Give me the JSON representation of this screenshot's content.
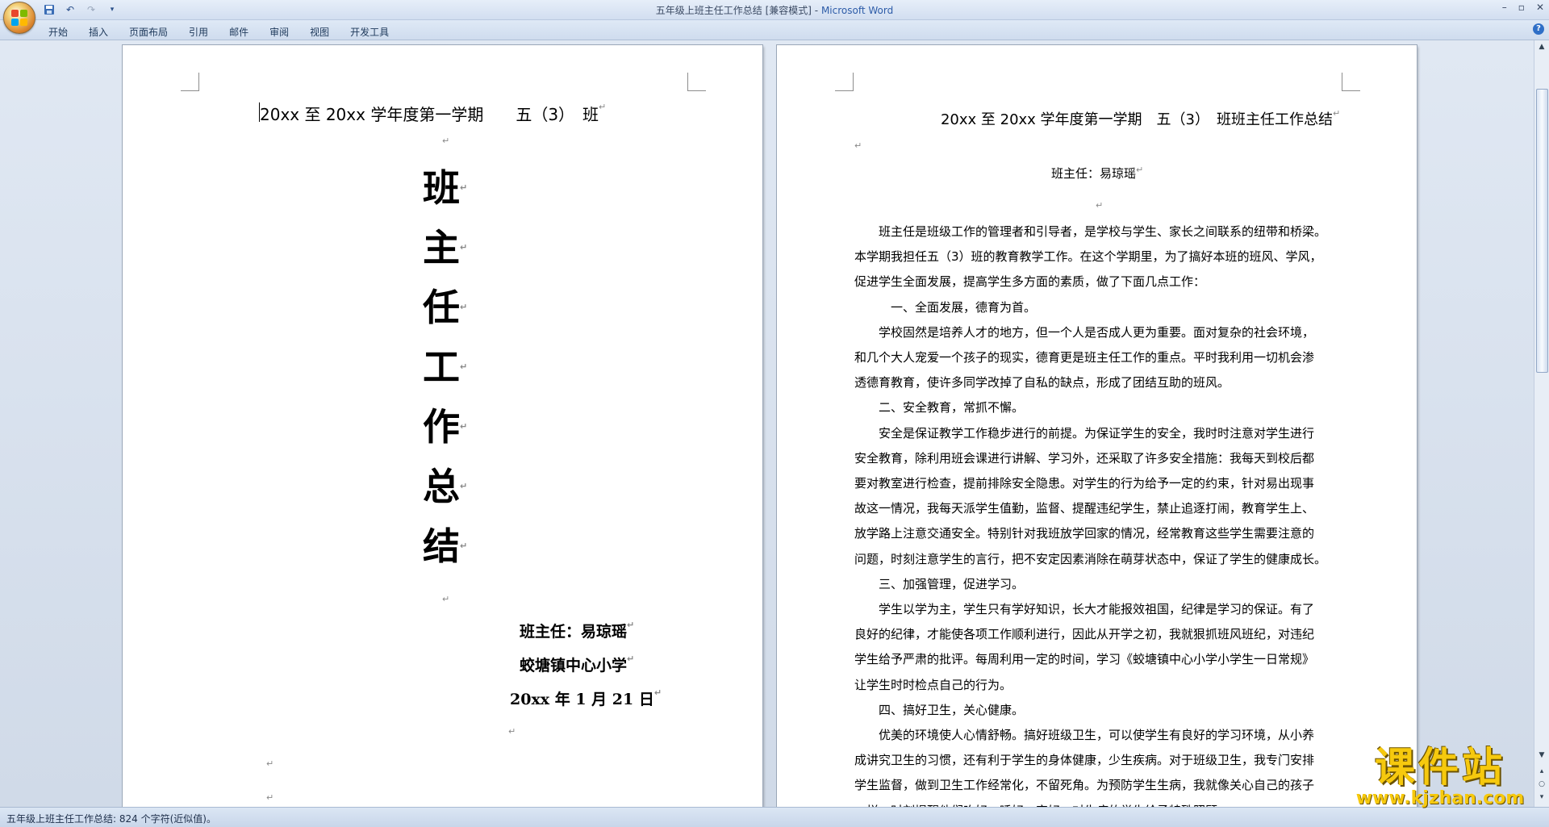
{
  "window": {
    "title": "五年级上班主任工作总结 [兼容模式]",
    "app_name": "Microsoft Word",
    "separator": " - "
  },
  "ribbon": {
    "tabs": [
      "开始",
      "插入",
      "页面布局",
      "引用",
      "邮件",
      "审阅",
      "视图",
      "开发工具"
    ]
  },
  "page1": {
    "header": "20xx 至 20xx 学年度第一学期　　五（3）　班",
    "title_chars": [
      "班",
      "主",
      "任",
      "工",
      "作",
      "总",
      "结"
    ],
    "teacher": "班主任：易琼瑶",
    "school": "蛟塘镇中心小学",
    "date": "20xx 年 1 月 21 日"
  },
  "page2": {
    "header": "20xx 至 20xx 学年度第一学期　五（3）　班班主任工作总结",
    "teacher": "班主任：易琼瑶",
    "lines": [
      "　　班主任是班级工作的管理者和引导者，是学校与学生、家长之间联系的纽带和桥梁。",
      "本学期我担任五（3）班的教育教学工作。在这个学期里，为了搞好本班的班风、学风，",
      "促进学生全面发展，提高学生多方面的素质，做了下面几点工作：",
      "　　　一、全面发展，德育为首。",
      "　　学校固然是培养人才的地方，但一个人是否成人更为重要。面对复杂的社会环境，",
      "和几个大人宠爱一个孩子的现实，德育更是班主任工作的重点。平时我利用一切机会渗",
      "透德育教育，使许多同学改掉了自私的缺点，形成了团结互助的班风。",
      "　　二、安全教育，常抓不懈。",
      "　　安全是保证教学工作稳步进行的前提。为保证学生的安全，我时时注意对学生进行",
      "安全教育，除利用班会课进行讲解、学习外，还采取了许多安全措施：我每天到校后都",
      "要对教室进行检查，提前排除安全隐患。对学生的行为给予一定的约束，针对易出现事",
      "故这一情况，我每天派学生值勤，监督、提醒违纪学生，禁止追逐打闹，教育学生上、",
      "放学路上注意交通安全。特别针对我班放学回家的情况，经常教育这些学生需要注意的",
      "问题，时刻注意学生的言行，把不安定因素消除在萌芽状态中，保证了学生的健康成长。",
      "　　三、加强管理，促进学习。",
      "　　学生以学为主，学生只有学好知识，长大才能报效祖国，纪律是学习的保证。有了",
      "良好的纪律，才能使各项工作顺利进行，因此从开学之初，我就狠抓班风班纪，对违纪",
      "学生给予严肃的批评。每周利用一定的时间，学习《蛟塘镇中心小学小学生一日常规》",
      "让学生时时检点自己的行为。",
      "　　四、搞好卫生，关心健康。",
      "　　优美的环境使人心情舒畅。搞好班级卫生，可以使学生有良好的学习环境，从小养",
      "成讲究卫生的习惯，还有利于学生的身体健康，少生疾病。对于班级卫生，我专门安排",
      "学生监督，做到卫生工作经常化，不留死角。为预防学生生病，我就像关心自己的孩子",
      "一样，时刻提醒他们吃好、睡好、穿好，对生病的学生给予特殊照顾。"
    ]
  },
  "status": {
    "text": "五年级上班主任工作总结: 824 个字符(近似值)。"
  },
  "watermark": {
    "title": "课件站",
    "url": "www.kjzhan.com"
  },
  "icons": {
    "office_button": "office-logo-icon",
    "save": "save-icon",
    "undo": "undo-icon",
    "redo": "redo-icon",
    "help": "help-icon"
  }
}
